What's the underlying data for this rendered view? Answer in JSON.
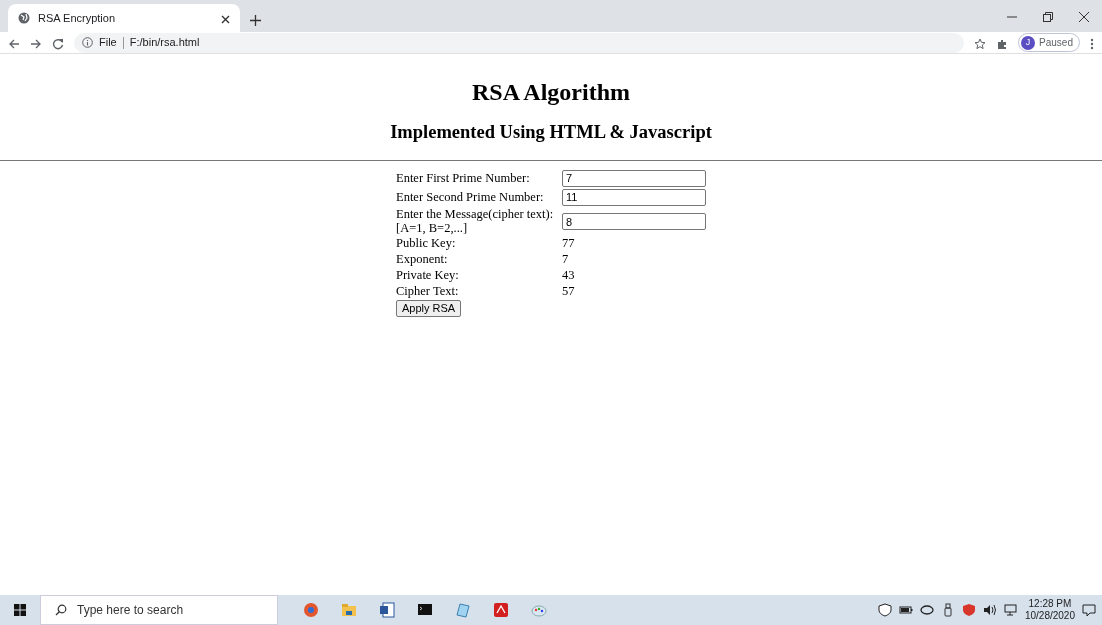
{
  "browser": {
    "tabs": [
      {
        "title": "RSA Encryption",
        "selected": true
      }
    ],
    "address": {
      "scheme": "File",
      "url": "F:/bin/rsa.html"
    },
    "profile": {
      "initial": "J",
      "status": "Paused"
    }
  },
  "page": {
    "heading": "RSA Algorithm",
    "subheading": "Implemented Using HTML & Javascript",
    "fields": [
      {
        "kind": "input",
        "label": "Enter First Prime Number:",
        "value": "7"
      },
      {
        "kind": "input",
        "label": "Enter Second Prime Number:",
        "value": "11"
      },
      {
        "kind": "input",
        "label": "Enter the Message(cipher text): [A=1, B=2,...]",
        "value": "8"
      },
      {
        "kind": "output",
        "label": "Public Key:",
        "value": "77"
      },
      {
        "kind": "output",
        "label": "Exponent:",
        "value": "7"
      },
      {
        "kind": "output",
        "label": "Private Key:",
        "value": "43"
      },
      {
        "kind": "output",
        "label": "Cipher Text:",
        "value": "57"
      }
    ],
    "button": "Apply RSA"
  },
  "taskbar": {
    "search_placeholder": "Type here to search",
    "time": "12:28 PM",
    "date": "10/28/2020"
  }
}
